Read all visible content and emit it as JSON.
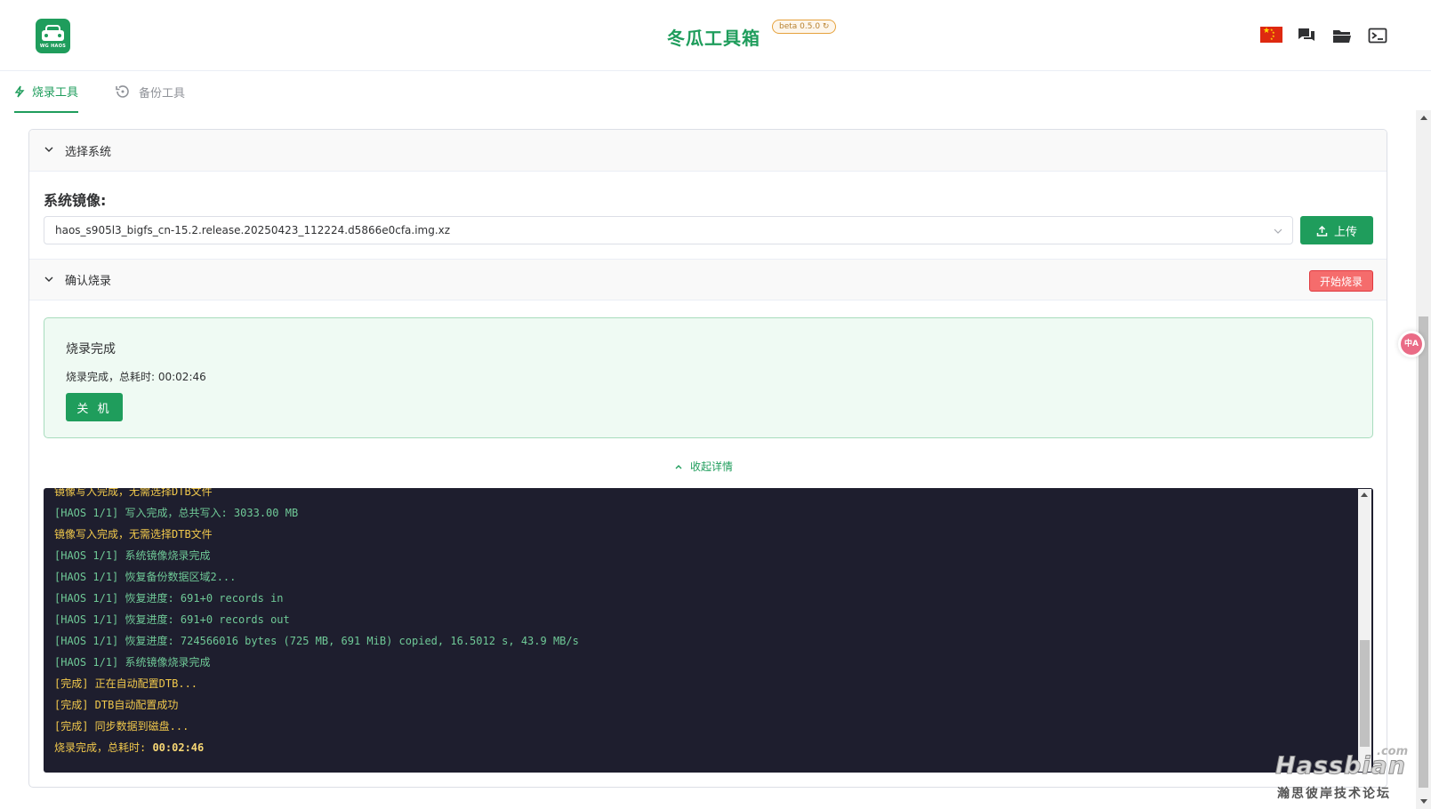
{
  "header": {
    "logo_text": "WG HAOS",
    "title": "冬瓜工具箱",
    "beta": "beta 0.5.0"
  },
  "tabs": [
    {
      "label": "烧录工具",
      "active": true,
      "icon": "lightning-icon"
    },
    {
      "label": "备份工具",
      "active": false,
      "icon": "history-icon"
    }
  ],
  "select_system": {
    "title": "选择系统",
    "image_label": "系统镜像:",
    "image_value": "haos_s905l3_bigfs_cn-15.2.release.20250423_112224.d5866e0cfa.img.xz",
    "upload_label": "上传"
  },
  "confirm": {
    "title": "确认烧录",
    "start_label": "开始烧录"
  },
  "result": {
    "title": "烧录完成",
    "description": "烧录完成，总耗时: 00:02:46",
    "shutdown_label": "关 机"
  },
  "collapse_label": "收起详情",
  "log": [
    {
      "type": "warn",
      "text": "镜像写入完成，无需选择DTB文件"
    },
    {
      "type": "info",
      "text": "[HAOS 1/1] 写入完成，总共写入: 3033.00 MB"
    },
    {
      "type": "warn",
      "text": "镜像写入完成，无需选择DTB文件"
    },
    {
      "type": "info",
      "text": "[HAOS 1/1] 系统镜像烧录完成"
    },
    {
      "type": "info",
      "text": "[HAOS 1/1] 恢复备份数据区域2..."
    },
    {
      "type": "info",
      "text": "[HAOS 1/1] 恢复进度: 691+0 records in"
    },
    {
      "type": "info",
      "text": "[HAOS 1/1] 恢复进度: 691+0 records out"
    },
    {
      "type": "info",
      "text": "[HAOS 1/1] 恢复进度: 724566016 bytes (725 MB, 691 MiB) copied, 16.5012 s, 43.9 MB/s"
    },
    {
      "type": "info",
      "text": "[HAOS 1/1] 系统镜像烧录完成"
    },
    {
      "type": "done",
      "text": "[完成] 正在自动配置DTB..."
    },
    {
      "type": "done",
      "text": "[完成] DTB自动配置成功"
    },
    {
      "type": "done",
      "text": "[完成] 同步数据到磁盘..."
    }
  ],
  "final_line": {
    "label": "烧录完成，总耗时: ",
    "time": "00:02:46"
  },
  "translate_badge": "中A",
  "watermark": {
    "com": ".com",
    "name": "Hassbian",
    "sub": "瀚思彼岸技术论坛"
  },
  "colors": {
    "primary": "#1f9d5c",
    "danger": "#f56c6c",
    "terminal_bg": "#1e1e2e"
  }
}
